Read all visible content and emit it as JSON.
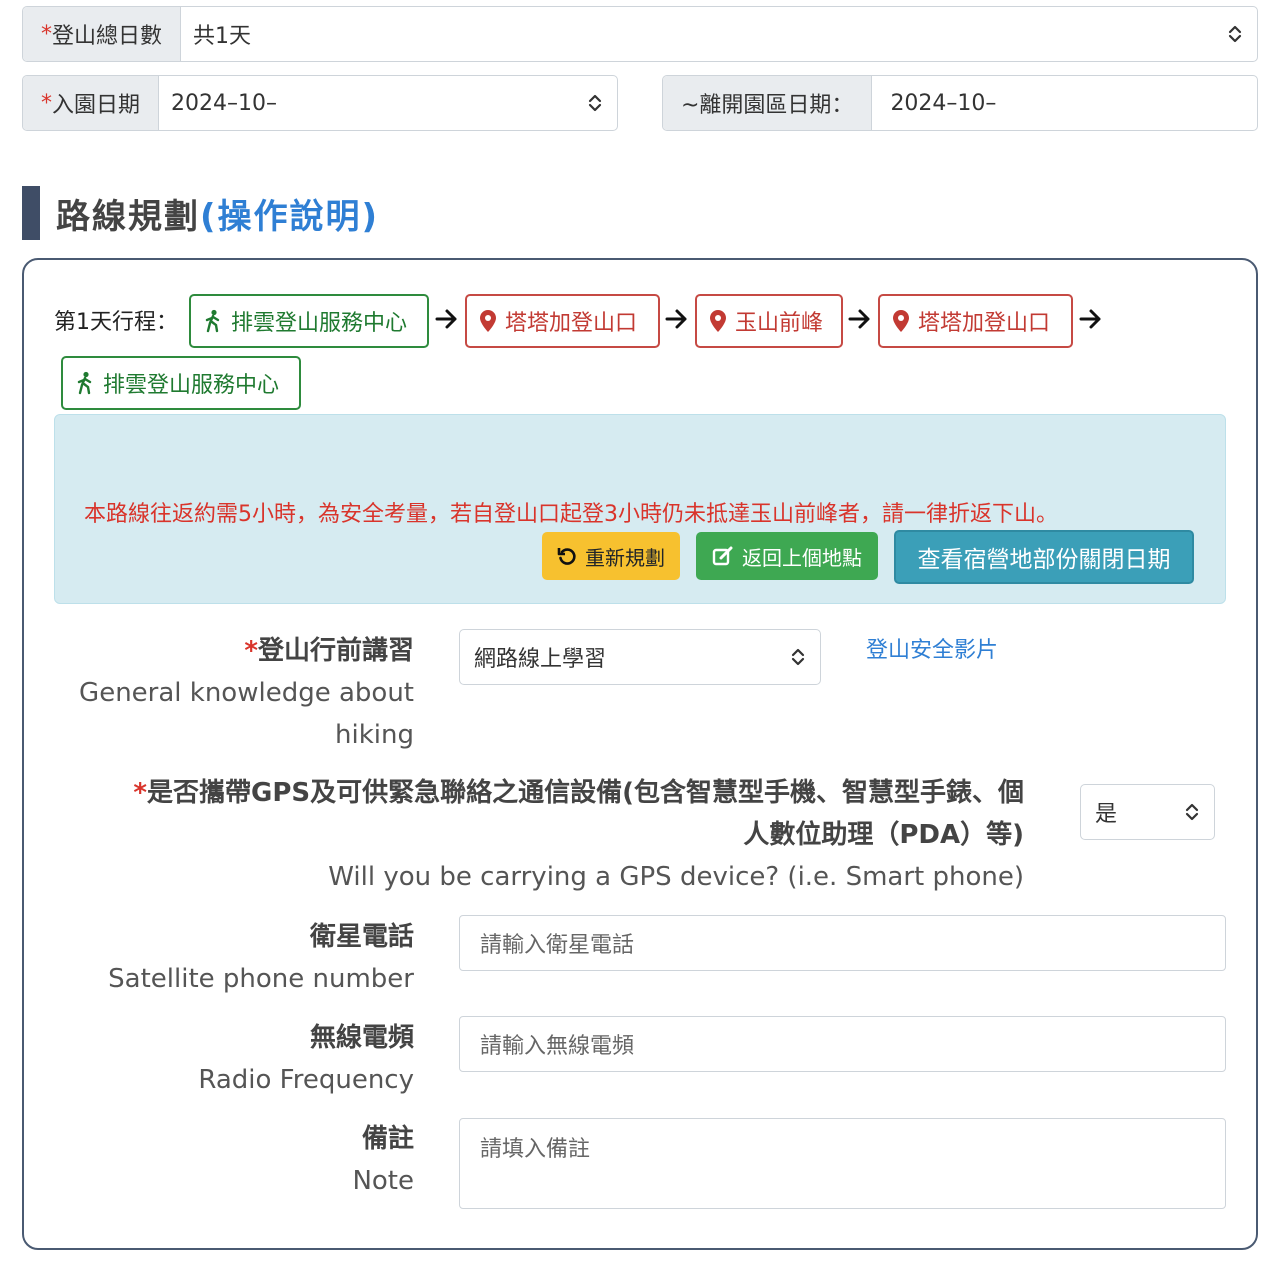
{
  "top": {
    "total_days": {
      "required": "*",
      "label": "登山總日數",
      "value": "共1天"
    },
    "enter_date": {
      "required": "*",
      "label": "入園日期",
      "value": "2024–10–"
    },
    "leave_date": {
      "label": "~離開園區日期：",
      "value": "2024–10–"
    }
  },
  "section": {
    "title": "路線規劃",
    "help_link": "(操作說明)"
  },
  "itinerary": {
    "day_label": "第1天行程：",
    "stops": [
      {
        "name": "排雲登山服務中心",
        "kind": "hiker"
      },
      {
        "name": "塔塔加登山口",
        "kind": "pin"
      },
      {
        "name": "玉山前峰",
        "kind": "pin"
      },
      {
        "name": "塔塔加登山口",
        "kind": "pin"
      },
      {
        "name": "排雲登山服務中心",
        "kind": "hiker"
      }
    ]
  },
  "alert": {
    "message": "本路線往返約需5小時，為安全考量，若自登山口起登3小時仍未抵達玉山前峰者，請一律折返下山。",
    "replan_label": "重新規劃",
    "back_label": "返回上個地點",
    "campsite_label": "查看宿營地部份關閉日期"
  },
  "form": {
    "briefing": {
      "required": "*",
      "label_zh": "登山行前講習",
      "label_en_1": "General knowledge about",
      "label_en_2": "hiking",
      "value": "網路線上學習",
      "video_link": "登山安全影片"
    },
    "gps": {
      "required": "*",
      "label_zh_1": "是否攜帶GPS及可供緊急聯絡之通信設備(包含智慧型手機、智慧型手錶、個",
      "label_zh_2": "人數位助理（PDA）等)",
      "label_en": "Will you be carrying a GPS device? (i.e. Smart phone)",
      "value": "是"
    },
    "satellite": {
      "label_zh": "衛星電話",
      "label_en": "Satellite phone number",
      "placeholder": "請輸入衛星電話"
    },
    "radio": {
      "label_zh": "無線電頻",
      "label_en": "Radio Frequency",
      "placeholder": "請輸入無線電頻"
    },
    "note": {
      "label_zh": "備註",
      "label_en": "Note",
      "placeholder": "請填入備註"
    }
  },
  "colors": {
    "accent_blue": "#2f7fd4",
    "danger_red": "#d9342b",
    "success_green": "#3ea852",
    "warning_yellow": "#f7c12f",
    "info_teal": "#3b9fb8",
    "alert_bg": "#d6ebf1"
  }
}
